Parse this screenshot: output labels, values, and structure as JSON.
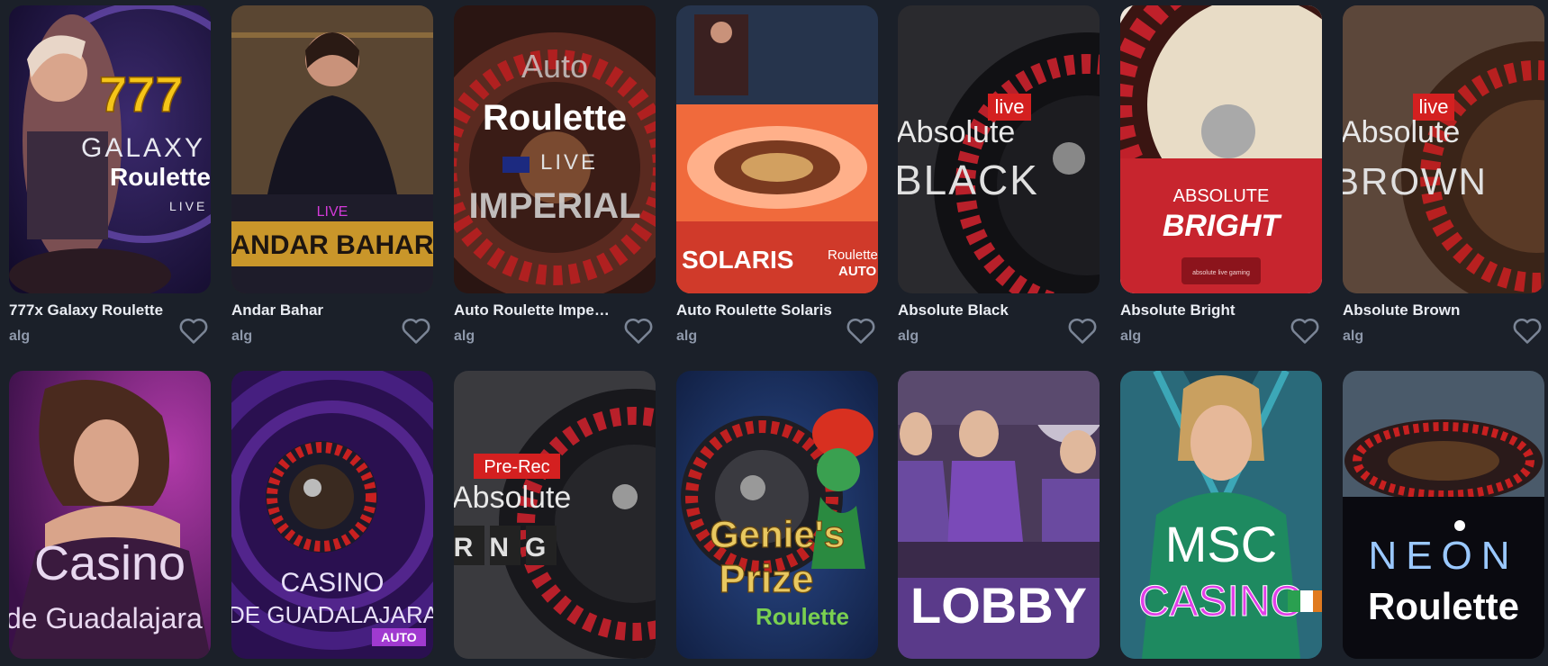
{
  "games": [
    {
      "name": "777x Galaxy Roulette",
      "provider": "alg",
      "art": [
        "777",
        "GALAXY",
        "Roulette",
        "LIVE"
      ]
    },
    {
      "name": "Andar Bahar",
      "provider": "alg",
      "art": [
        "LIVE",
        "ANDAR BAHAR"
      ]
    },
    {
      "name": "Auto Roulette Impe…",
      "provider": "alg",
      "art": [
        "Auto",
        "Roulette",
        "LIVE",
        "IMPERIAL"
      ]
    },
    {
      "name": "Auto Roulette Solaris",
      "provider": "alg",
      "art": [
        "SOLARIS",
        "Roulette",
        "AUTO"
      ]
    },
    {
      "name": "Absolute Black",
      "provider": "alg",
      "art": [
        "live",
        "Absolute",
        "BLACK"
      ]
    },
    {
      "name": "Absolute Bright",
      "provider": "alg",
      "art": [
        "ABSOLUTE",
        "BRIGHT",
        "absolute live gaming"
      ]
    },
    {
      "name": "Absolute Brown",
      "provider": "alg",
      "art": [
        "live",
        "Absolute",
        "BROWN"
      ]
    },
    {
      "art": [
        "Casino",
        "de Guadalajara"
      ]
    },
    {
      "art": [
        "CASINO",
        "DE GUADALAJARA",
        "AUTO"
      ]
    },
    {
      "art": [
        "Pre-Rec",
        "Absolute",
        "RNG"
      ]
    },
    {
      "art": [
        "Genie's",
        "Prize",
        "Roulette"
      ]
    },
    {
      "art": [
        "LOBBY"
      ]
    },
    {
      "art": [
        "MSC",
        "CASINO"
      ]
    },
    {
      "art": [
        "NEON",
        "Roulette"
      ]
    }
  ],
  "icons": {
    "favorite": "heart-icon"
  },
  "colors": {
    "background": "#1b2029",
    "title": "#e9ecf2",
    "provider": "#8e98aa",
    "heart": "#7b8596"
  }
}
